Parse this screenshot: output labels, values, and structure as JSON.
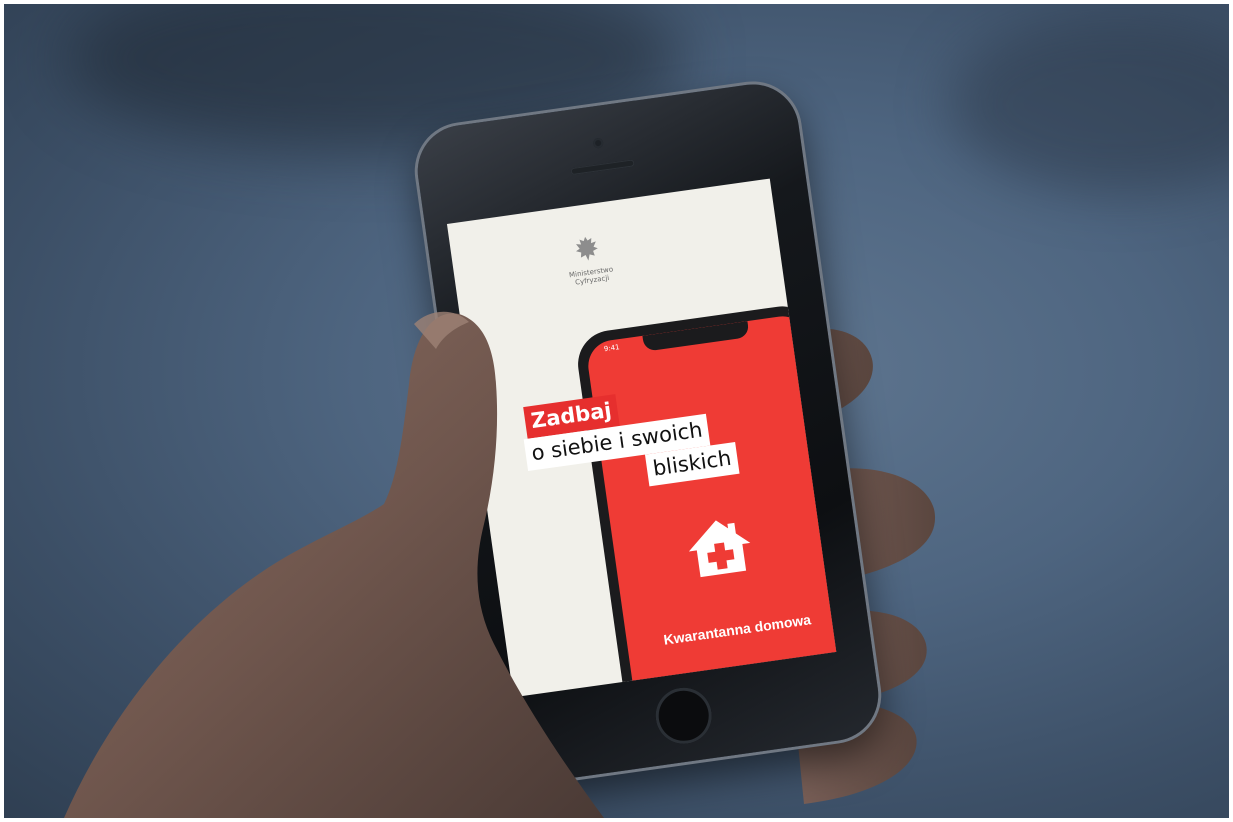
{
  "screen": {
    "ministry_name": "Ministerstwo\nCyfryzacji",
    "headline_line1": "Zadbaj",
    "headline_line2": "o siebie i swoich",
    "headline_line3": "bliskich",
    "mock_phone_time": "9:41",
    "app_name": "Kwarantanna domowa"
  },
  "colors": {
    "accent_red": "#ef3b35",
    "headline_red": "#e62f2e",
    "background_blue": "#4e6580"
  },
  "icons": {
    "logo": "polish-eagle-icon",
    "app_icon": "house-with-cross-icon"
  }
}
